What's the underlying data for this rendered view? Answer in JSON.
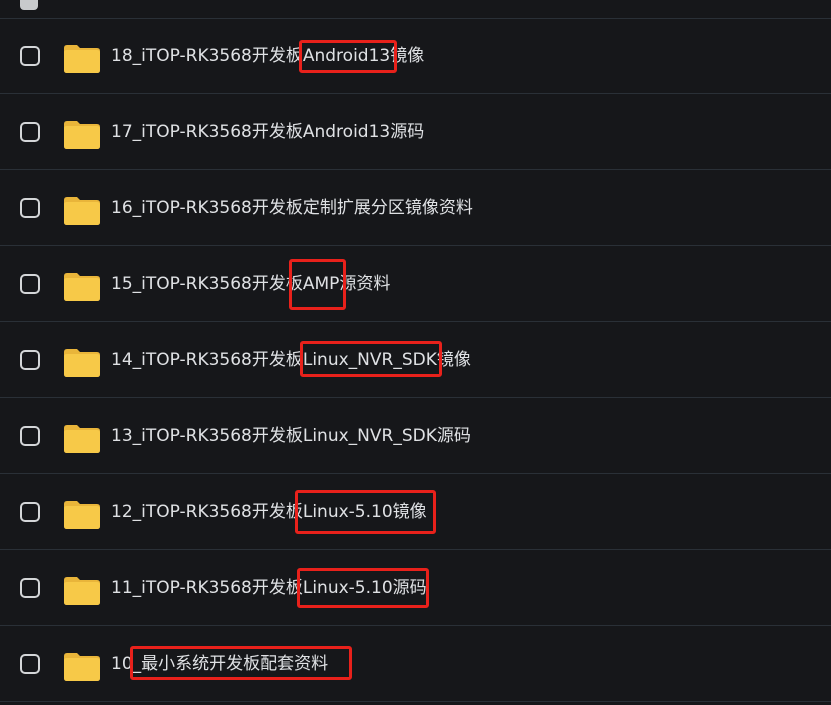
{
  "files": [
    {
      "name": "18_iTOP-RK3568开发板Android13镜像"
    },
    {
      "name": "17_iTOP-RK3568开发板Android13源码"
    },
    {
      "name": "16_iTOP-RK3568开发板定制扩展分区镜像资料"
    },
    {
      "name": "15_iTOP-RK3568开发板AMP源资料"
    },
    {
      "name": "14_iTOP-RK3568开发板Linux_NVR_SDK镜像"
    },
    {
      "name": "13_iTOP-RK3568开发板Linux_NVR_SDK源码"
    },
    {
      "name": "12_iTOP-RK3568开发板Linux-5.10镜像"
    },
    {
      "name": "11_iTOP-RK3568开发板Linux-5.10源码"
    },
    {
      "name": "10_最小系统开发板配套资料"
    }
  ],
  "icons": {
    "folder": "folder-icon",
    "checkbox": "checkbox"
  },
  "colors": {
    "background": "#16171a",
    "divider": "#2a3037",
    "folder": "#f7c948",
    "highlight": "#e8211b",
    "text": "#dfe1e4"
  }
}
